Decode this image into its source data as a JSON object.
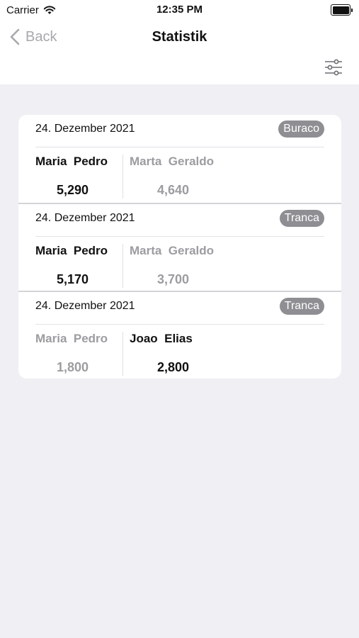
{
  "status_bar": {
    "carrier": "Carrier",
    "time": "12:35 PM",
    "icons": [
      "wifi-icon",
      "battery-icon"
    ]
  },
  "nav": {
    "back_label": "Back",
    "title": "Statistik",
    "filter_icon": "sliders-icon"
  },
  "colors": {
    "background": "#efeff4",
    "badge": "#8e8e93",
    "winner_text": "#111111",
    "loser_text": "#9c9ca1",
    "back_text": "#a8a8ad"
  },
  "games": [
    {
      "date": "24. Dezember 2021",
      "type": "Buraco",
      "team1": {
        "names": "Maria  Pedro",
        "score": "5,290",
        "winner": true
      },
      "team2": {
        "names": "Marta  Geraldo",
        "score": "4,640",
        "winner": false
      }
    },
    {
      "date": "24. Dezember 2021",
      "type": "Tranca",
      "team1": {
        "names": "Maria  Pedro",
        "score": "5,170",
        "winner": true
      },
      "team2": {
        "names": "Marta  Geraldo",
        "score": "3,700",
        "winner": false
      }
    },
    {
      "date": "24. Dezember 2021",
      "type": "Tranca",
      "team1": {
        "names": "Maria  Pedro",
        "score": "1,800",
        "winner": false
      },
      "team2": {
        "names": "Joao  Elias",
        "score": "2,800",
        "winner": true
      }
    }
  ]
}
